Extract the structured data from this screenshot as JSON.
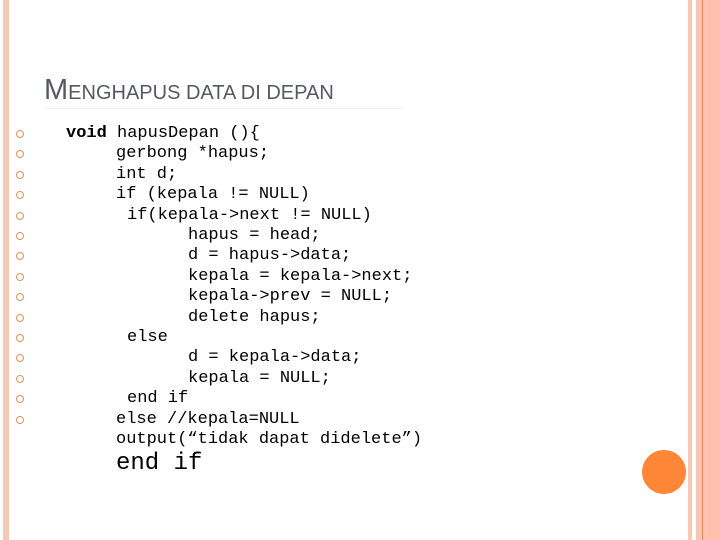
{
  "slide": {
    "title_first_letter": "M",
    "title_rest": "ENGHAPUS DATA DI DEPAN",
    "accent_color": "#fe8637",
    "border_color": "#f9c7b5",
    "bullet_color": "#d9935f"
  },
  "code": {
    "lines": [
      {
        "keyword": "void",
        "text": " hapusDepan (){",
        "indent": 0,
        "bulleted": true
      },
      {
        "text": "gerbong *hapus;",
        "indent": 1,
        "bulleted": true
      },
      {
        "text": "int d;",
        "indent": 1,
        "bulleted": true
      },
      {
        "text": "if (kepala != NULL)",
        "indent": 1,
        "bulleted": true
      },
      {
        "text": "if(kepala->next != NULL)",
        "indent": 2,
        "bulleted": true
      },
      {
        "text": "hapus = head;",
        "indent": 3,
        "bulleted": true
      },
      {
        "text": "d = hapus->data;",
        "indent": 3,
        "bulleted": true
      },
      {
        "text": "kepala = kepala->next;",
        "indent": 3,
        "bulleted": true
      },
      {
        "text": "kepala->prev = NULL;",
        "indent": 3,
        "bulleted": true
      },
      {
        "text": "delete hapus;",
        "indent": 3,
        "bulleted": true
      },
      {
        "text": "else",
        "indent": 2,
        "bulleted": true
      },
      {
        "text": "d = kepala->data;",
        "indent": 3,
        "bulleted": true
      },
      {
        "text": "kepala = NULL;",
        "indent": 3,
        "bulleted": true
      },
      {
        "text": "end if",
        "indent": 2,
        "bulleted": true
      },
      {
        "text": "else //kepala=NULL",
        "indent": 1,
        "bulleted": true
      },
      {
        "text": "output(“tidak dapat didelete”)",
        "indent": 1,
        "bulleted": false
      },
      {
        "text": "end if",
        "indent": 1,
        "bulleted": false
      }
    ]
  }
}
